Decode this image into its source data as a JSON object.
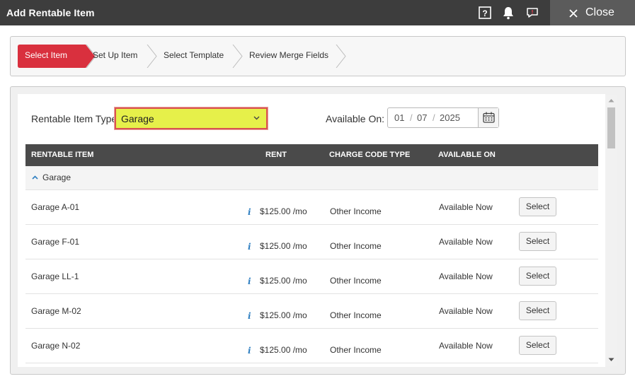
{
  "window": {
    "title": "Add Rentable Item",
    "close_label": "Close",
    "icons": [
      "help-icon",
      "bell-icon",
      "chat-icon",
      "close-icon"
    ]
  },
  "wizard": {
    "steps": [
      {
        "label": "Select Item",
        "active": true
      },
      {
        "label": "Set Up Item",
        "active": false
      },
      {
        "label": "Select Template",
        "active": false
      },
      {
        "label": "Review Merge Fields",
        "active": false
      }
    ]
  },
  "filters": {
    "type_label": "Rentable Item Type:",
    "type_value": "Garage",
    "available_label": "Available On:",
    "date": {
      "month": "01",
      "day": "07",
      "year": "2025"
    }
  },
  "table": {
    "columns": [
      "RENTABLE ITEM",
      "RENT",
      "CHARGE CODE TYPE",
      "AVAILABLE ON"
    ],
    "group": "Garage",
    "info_glyph": "i",
    "rows": [
      {
        "name": "Garage A-01",
        "rent": "$125.00 /mo",
        "charge_code": "Other Income",
        "available": "Available Now",
        "action": "Select"
      },
      {
        "name": "Garage F-01",
        "rent": "$125.00 /mo",
        "charge_code": "Other Income",
        "available": "Available Now",
        "action": "Select"
      },
      {
        "name": "Garage LL-1",
        "rent": "$125.00 /mo",
        "charge_code": "Other Income",
        "available": "Available Now",
        "action": "Select"
      },
      {
        "name": "Garage M-02",
        "rent": "$125.00 /mo",
        "charge_code": "Other Income",
        "available": "Available Now",
        "action": "Select"
      },
      {
        "name": "Garage N-02",
        "rent": "$125.00 /mo",
        "charge_code": "Other Income",
        "available": "Available Now",
        "action": "Select"
      }
    ]
  },
  "colors": {
    "titlebar": "#3d3d3d",
    "active_step": "#d9303e",
    "highlight_select": "#e6f04a",
    "highlight_border": "#d9534f",
    "table_header": "#4a4a4a",
    "info_icon": "#2f7fc1"
  }
}
